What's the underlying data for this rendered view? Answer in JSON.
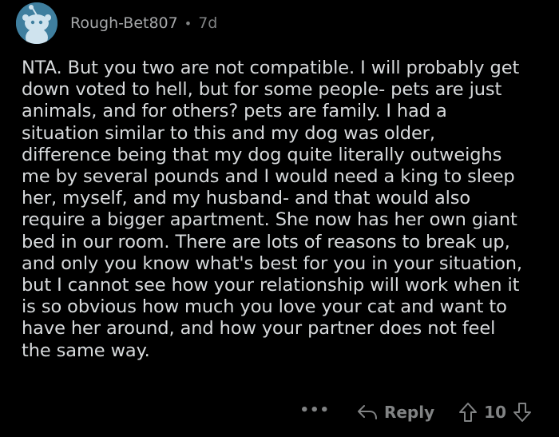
{
  "comment": {
    "username": "Rough-Bet807",
    "separator": "•",
    "age": "7d",
    "avatar_icon": "reddit-snoo-icon",
    "body": "NTA. But you two are not compatible. I will probably get\ndown voted to hell, but for some people- pets are just\nanimals, and for others? pets are family. I had a\nsituation similar to this and my dog was older,\ndifference being that my dog quite literally outweighs\nme by several pounds and I would need a king to sleep\nher, myself, and my husband- and that would also\nrequire a bigger apartment. She now has her own giant\nbed in our room. There are lots of reasons to break up,\nand only you know what's best for you in your situation,\nbut I cannot see how your relationship will work when it\nis so obvious how much you love your cat and want to\nhave her around, and how your partner does not feel\nthe same way."
  },
  "actions": {
    "more_label": "•••",
    "reply_label": "Reply",
    "vote_count": "10",
    "icons": [
      "more-icon",
      "reply-icon",
      "upvote-icon",
      "downvote-icon"
    ]
  },
  "colors": {
    "background": "#000000",
    "text": "#d7dadc",
    "muted": "#818384",
    "avatar_bg": "#3f7f9f"
  }
}
